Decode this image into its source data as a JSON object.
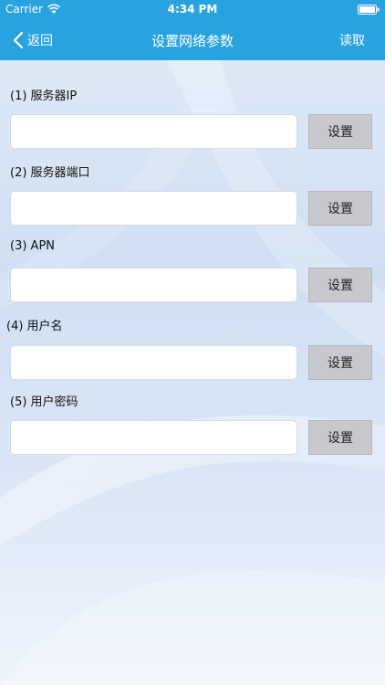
{
  "status_bar": {
    "carrier": "Carrier",
    "time": "4:34 PM",
    "wifi_icon": "wifi-icon",
    "battery_icon": "battery-icon"
  },
  "nav": {
    "back_icon": "chevron-left-icon",
    "back_label": "返回",
    "title": "设置网络参数",
    "read_label": "读取"
  },
  "fields": [
    {
      "label": "(1) 服务器IP",
      "value": "",
      "button": "设置"
    },
    {
      "label": "(2) 服务器端口",
      "value": "",
      "button": "设置"
    },
    {
      "label": "(3) APN",
      "value": "",
      "button": "设置"
    },
    {
      "label": "(4) 用户名",
      "value": "",
      "button": "设置"
    },
    {
      "label": "(5) 用户密码",
      "value": "",
      "button": "设置"
    }
  ],
  "colors": {
    "nav_background": "#28a3e0",
    "button_background": "#c8c9cc"
  }
}
